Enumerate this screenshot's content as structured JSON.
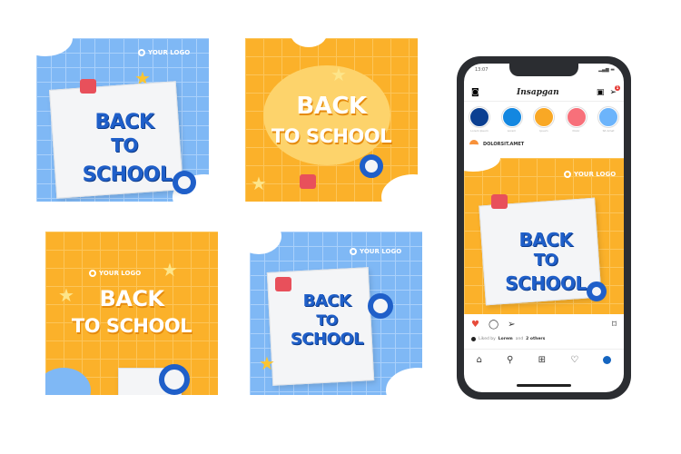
{
  "posts": [
    {
      "logo": "YOUR LOGO",
      "line1": "BACK",
      "line2": "TO",
      "line3": "SCHOOL"
    },
    {
      "logo": "",
      "line1": "BACK",
      "line2": "TO SCHOOL"
    },
    {
      "logo": "YOUR LOGO",
      "line1": "BACK",
      "line2": "TO SCHOOL"
    },
    {
      "logo": "YOUR LOGO",
      "line1": "BACK",
      "line2": "TO",
      "line3": "SCHOOL"
    }
  ],
  "phone": {
    "time": "13:07",
    "app_title": "Insapgan",
    "notification_count": "1",
    "stories": [
      {
        "label": "Lorem Ipsum",
        "color": "#0b3f91"
      },
      {
        "label": "Lorem",
        "color": "#1387e0"
      },
      {
        "label": "Ipsum",
        "color": "#f9a825"
      },
      {
        "label": "Dolor",
        "color": "#f7707a"
      },
      {
        "label": "Sit Amet",
        "color": "#6cb4fb"
      }
    ],
    "username": "DOLORSIT.AMET",
    "post": {
      "logo": "YOUR LOGO",
      "line1": "BACK",
      "line2": "TO",
      "line3": "SCHOOL"
    },
    "liked_prefix": "Liked by",
    "liked_user": "Lorem",
    "liked_mid": "and",
    "liked_others": "2 others",
    "icons": [
      "heart-icon",
      "comment-icon",
      "send-icon",
      "bookmark-icon",
      "home-icon",
      "search-icon",
      "add-icon",
      "activity-heart-icon",
      "profile-icon"
    ]
  }
}
